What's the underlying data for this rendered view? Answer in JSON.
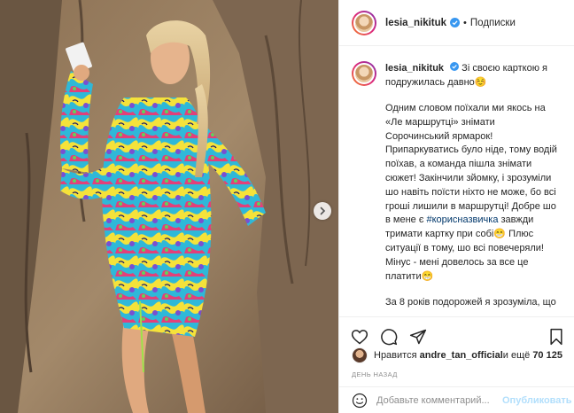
{
  "post": {
    "username": "lesia_nikituk",
    "verified_icon": "verified-badge-icon",
    "dot": "•",
    "follow_label": "Подписки"
  },
  "caption": {
    "username": "lesia_nikituk",
    "line1": "Зі своєю карткою я подружилась давно☺️",
    "p1_a": "Одним словом поїхали ми якось на «Ле маршрутці» знімати Сорочинський ярмарок! Припаркуватись було ніде, тому водій поїхав, а команда пішла знімати сюжет! Закінчили зйомку, і зрозуміли шо навіть поїсти ніхто не може, бо всі гроші лишили в маршрутці! Добре шо в мене є ",
    "hashtag": "#корисназвичка",
    "p1_b": " завжди тримати картку при собі😁 Плюс ситуації в тому, шо всі повечеряли! Мінус - мені довелось за все це платити😁",
    "p2": "За 8 років подорожей я зрозуміла, що"
  },
  "actions": {
    "like_icon": "heart-icon",
    "comment_icon": "comment-icon",
    "share_icon": "share-icon",
    "save_icon": "bookmark-icon"
  },
  "likes": {
    "prefix": "Нравится ",
    "user": "andre_tan_official",
    "middle": " и ещё ",
    "count": "70 125"
  },
  "timeago": "День назад",
  "comment_box": {
    "placeholder": "Добавьте комментарий...",
    "post_label": "Опубликовать"
  },
  "colors": {
    "link": "#00376b",
    "verified": "#3897f0",
    "post_disabled": "#b2dffc",
    "muted": "#8e8e8e"
  }
}
